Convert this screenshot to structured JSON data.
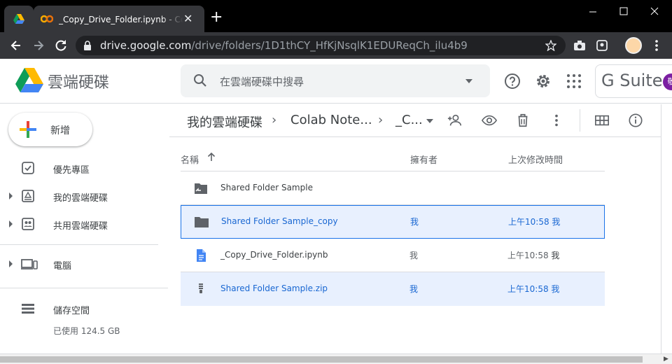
{
  "browser": {
    "tab_title": "_Copy_Drive_Folder.ipynb - Colab",
    "address_host": "drive.google.com",
    "address_path": "/drive/folders/1D1thCY_HfKjNsqlK1EDUReqCh_ilu4b9"
  },
  "drive": {
    "app_name": "雲端硬碟",
    "search_placeholder": "在雲端硬碟中搜尋",
    "gsuite_label": "G Suite",
    "gsuite_avatar_letter": "敬"
  },
  "sidebar": {
    "new_label": "新增",
    "items": [
      {
        "label": "優先專區"
      },
      {
        "label": "我的雲端硬碟"
      },
      {
        "label": "共用雲端硬碟"
      },
      {
        "label": "電腦"
      },
      {
        "label": "儲存空間"
      }
    ],
    "storage_used": "已使用 124.5 GB"
  },
  "breadcrumb": [
    "我的雲端硬碟",
    "Colab Note...",
    "_C..."
  ],
  "columns": {
    "name": "名稱",
    "owner": "擁有者",
    "modified": "上次修改時間"
  },
  "files": [
    {
      "name": "Shared Folder Sample",
      "owner": "",
      "modified": "",
      "modified_by": ""
    },
    {
      "name": "Shared Folder Sample_copy",
      "owner": "我",
      "modified": "上午10:58",
      "modified_by": "我"
    },
    {
      "name": "_Copy_Drive_Folder.ipynb",
      "owner": "我",
      "modified": "上午10:58",
      "modified_by": "我"
    },
    {
      "name": "Shared Folder Sample.zip",
      "owner": "我",
      "modified": "上午10:58",
      "modified_by": "我"
    }
  ],
  "colors": {
    "accent": "#1a73e8",
    "selected_bg": "#e8f0fe",
    "chrome_dark": "#35363a"
  }
}
